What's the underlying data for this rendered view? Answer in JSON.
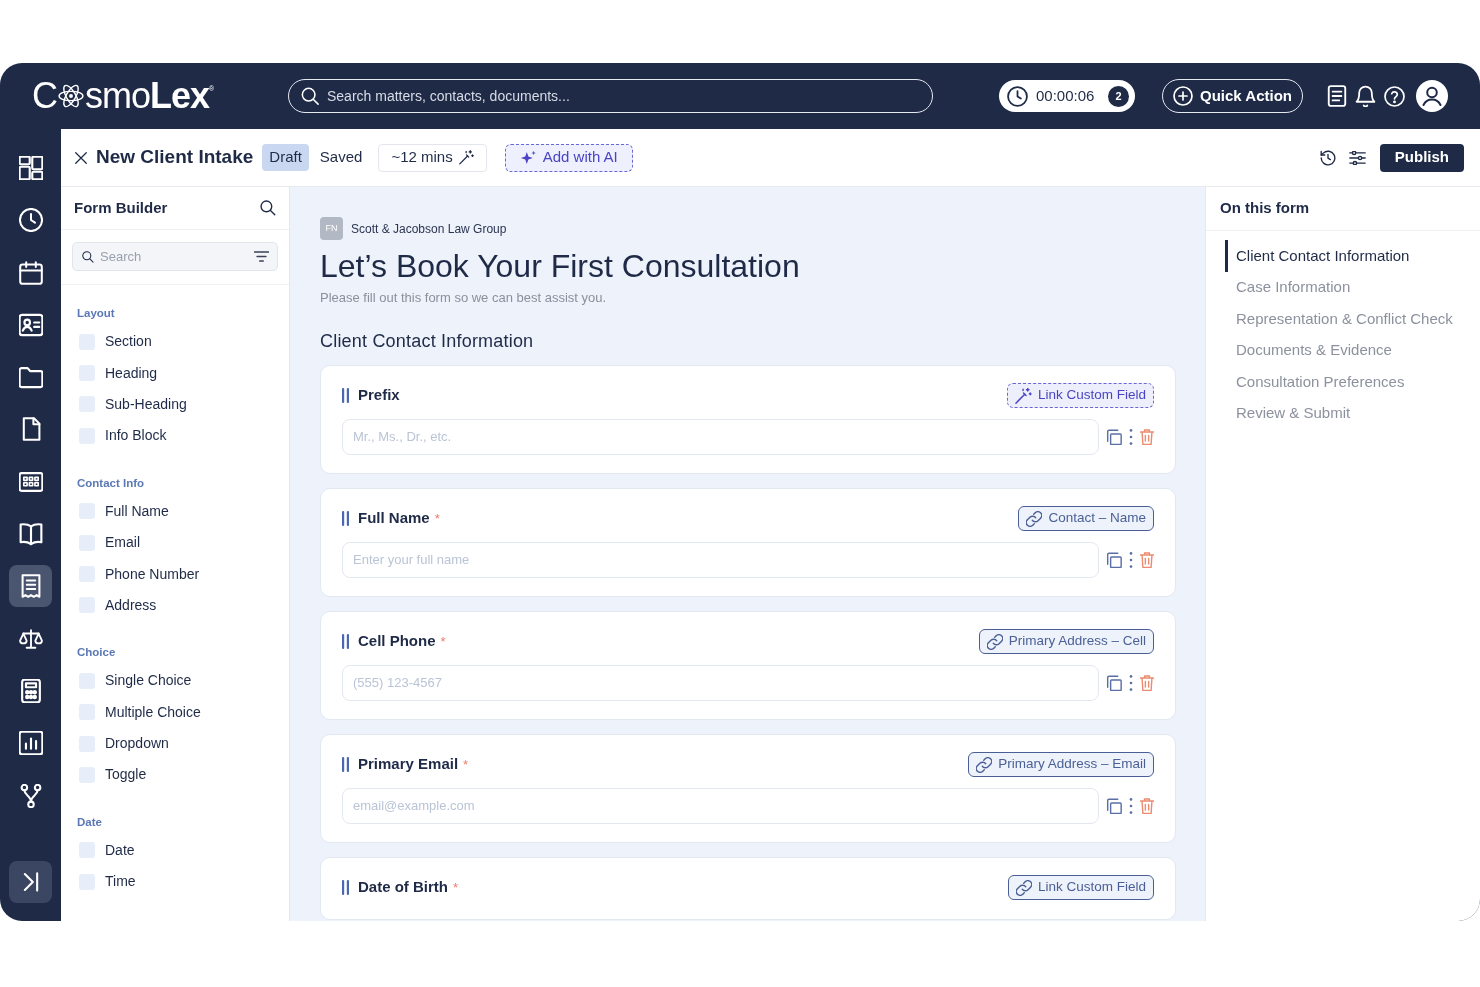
{
  "topbar": {
    "logo": {
      "first": "C",
      "rest": "smo**Lex**$^{®}$"
    },
    "search": {
      "placeholder": "Search matters, contacts, documents..."
    },
    "timer": {
      "time": "00:00:06",
      "count": "2"
    },
    "quick_action": "Quick Action"
  },
  "nav_rail": {
    "items": [
      {
        "selected": false
      },
      {
        "selected": false
      },
      {
        "selected": false
      },
      {
        "selected": false
      },
      {
        "selected": false
      },
      {
        "selected": false
      },
      {
        "selected": false
      },
      {
        "selected": false
      },
      {
        "selected": true
      },
      {
        "selected": false
      },
      {
        "selected": false
      },
      {
        "selected": false
      },
      {
        "selected": false
      }
    ]
  },
  "header": {
    "title": "New Client Intake",
    "status": "Draft",
    "save_state": "Saved",
    "estimate": "~12 mins",
    "ai_button": "Add with AI",
    "publish_button": "Publish"
  },
  "form_builder": {
    "title": "Form Builder",
    "search": {
      "placeholder": "Search"
    },
    "groups": [
      {
        "label": "Layout",
        "items": [
          {
            "label": "Section"
          },
          {
            "label": "Heading"
          },
          {
            "label": "Sub-Heading"
          },
          {
            "label": "Info Block"
          }
        ]
      },
      {
        "label": "Contact Info",
        "items": [
          {
            "label": "Full Name"
          },
          {
            "label": "Email"
          },
          {
            "label": "Phone Number"
          },
          {
            "label": "Address"
          }
        ]
      },
      {
        "label": "Choice",
        "items": [
          {
            "label": "Single Choice"
          },
          {
            "label": "Multiple Choice"
          },
          {
            "label": "Dropdown"
          },
          {
            "label": "Toggle"
          }
        ]
      },
      {
        "label": "Date",
        "items": [
          {
            "label": "Date"
          },
          {
            "label": "Time"
          }
        ]
      }
    ]
  },
  "form": {
    "org": {
      "initials": "FN",
      "name": "Scott & Jacobson Law Group"
    },
    "title": "Let’s Book Your First Consultation",
    "subtitle": "Please fill out this form so we can best assist you.",
    "section_title": "Client Contact Information",
    "fields": [
      {
        "label": "Prefix",
        "badge": {
          "kind": "suggest",
          "text": "Link Custom Field"
        },
        "placeholder": "Mr., Ms., Dr., etc."
      },
      {
        "label": "Full Name",
        "required_mark": "*",
        "badge": {
          "kind": "linked",
          "text": "Contact – Name"
        },
        "placeholder": "Enter your full name"
      },
      {
        "label": "Cell Phone",
        "required_mark": "*",
        "badge": {
          "kind": "linked",
          "text": "Primary Address – Cell"
        },
        "placeholder": "(555) 123-4567"
      },
      {
        "label": "Primary Email",
        "required_mark": "*",
        "badge": {
          "kind": "linked",
          "text": "Primary Address – Email"
        },
        "placeholder": "email@example.com"
      },
      {
        "label": "Date of Birth",
        "required_mark": "*",
        "badge": {
          "kind": "linked",
          "text": "Link Custom Field"
        }
      }
    ]
  },
  "outline": {
    "title": "On this form",
    "sections": [
      {
        "label": "Client Contact Information",
        "selected": true
      },
      {
        "label": "Case Information",
        "selected": false
      },
      {
        "label": "Representation & Conflict Check",
        "selected": false
      },
      {
        "label": "Documents & Evidence",
        "selected": false
      },
      {
        "label": "Consultation Preferences",
        "selected": false
      },
      {
        "label": "Review & Submit",
        "selected": false
      }
    ]
  }
}
